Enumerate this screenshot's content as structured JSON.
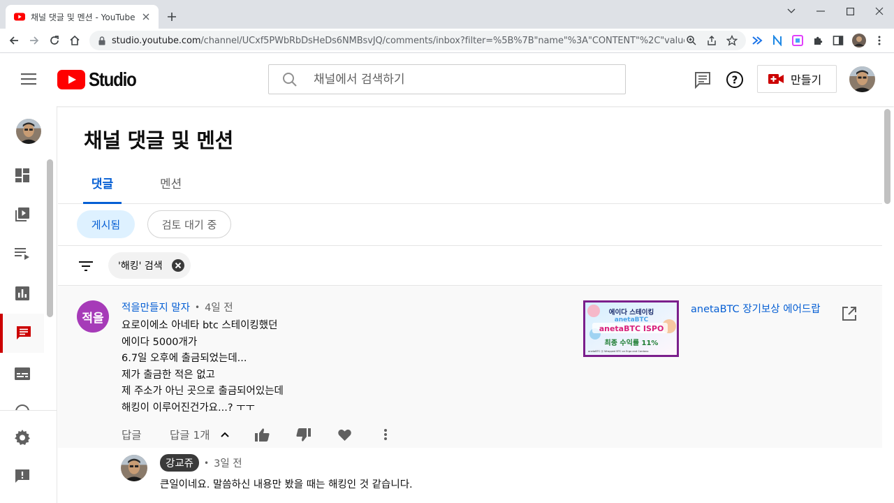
{
  "browser": {
    "tab_title": "채널 댓글 및 멘션 - YouTube Studio",
    "url_host": "studio.youtube.com",
    "url_path": "/channel/UCxf5PWbRbDsHeDs6NMBsvJQ/comments/inbox?filter=%5B%7B\"name\"%3A\"CONTENT\"%2C\"value\"%3A%7B\"..."
  },
  "header": {
    "logo_text": "Studio",
    "search_placeholder": "채널에서 검색하기",
    "create_label": "만들기"
  },
  "page": {
    "title": "채널 댓글 및 멘션",
    "tabs": [
      {
        "label": "댓글",
        "active": true
      },
      {
        "label": "멘션",
        "active": false
      }
    ],
    "chips": [
      {
        "label": "게시됨",
        "active": true
      },
      {
        "label": "검토 대기 중",
        "active": false
      }
    ],
    "filter_chip": "'해킹' 검색"
  },
  "comment": {
    "avatar_text": "적을",
    "author": "적을만들지 말자",
    "time": "4일 전",
    "lines": [
      "요로이에소 아네타 btc 스테이킹했던",
      "에이다 5000개가",
      "6.7일 오후에 출금되었는데...",
      "제가 출금한 적은 없고",
      "제 주소가 아닌 곳으로 출금되어있는데",
      "해킹이 이루어진건가요...? ㅜㅜ"
    ],
    "reply_label": "답글",
    "replies_label": "답글 1개",
    "video_title": "anetaBTC 장기보상 에어드랍",
    "thumbnail": {
      "line1": "에이다 스테이킹",
      "line2": "anetaBTC",
      "line3": "anetaBTC ISPO",
      "line4": "최종 수익률 11%",
      "footer": "anetaBTC ⓐ Wrapped BTC on Ergo and Cardano"
    }
  },
  "reply": {
    "author": "강교쥬",
    "time": "3일 전",
    "text": "큰일이네요. 말씀하신 내용만 봤을 때는 해킹인 것 같습니다."
  },
  "colors": {
    "accent_blue": "#065fd4",
    "youtube_red": "#ff0000",
    "active_rail": "#cc0000",
    "comment_avatar": "#a63bb8"
  }
}
